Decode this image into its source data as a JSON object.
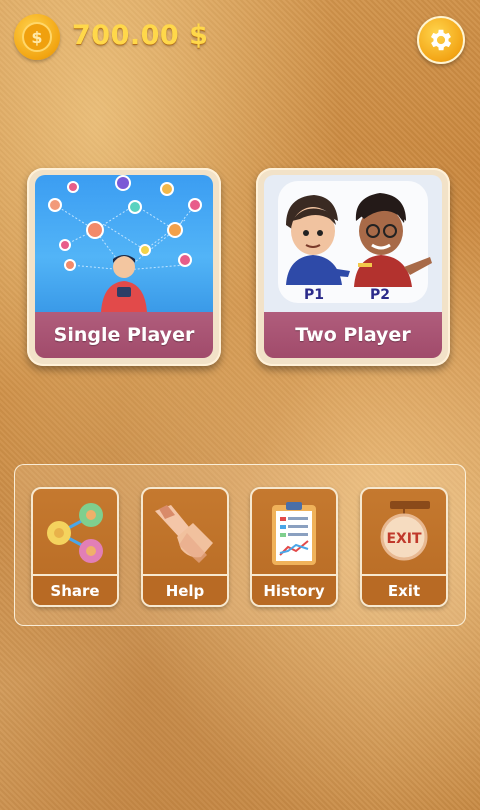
{
  "header": {
    "balance": "700.00 $",
    "coin_symbol": "$",
    "coin_icon": "coin-icon",
    "settings_icon": "gear-icon"
  },
  "modes": [
    {
      "label": "Single Player",
      "icon": "network-illustration"
    },
    {
      "label": "Two Player",
      "icon": "two-players-illustration",
      "badges": [
        "P1",
        "P2"
      ]
    }
  ],
  "menu": [
    {
      "label": "Share",
      "icon": "share-icon"
    },
    {
      "label": "Help",
      "icon": "handshake-icon"
    },
    {
      "label": "History",
      "icon": "clipboard-chart-icon"
    },
    {
      "label": "Exit",
      "icon": "exit-sign-icon",
      "sign_text": "EXIT"
    }
  ],
  "colors": {
    "accent_gold": "#ffd84a",
    "card_label": "#a14b6b",
    "menu_tile": "#b86b24"
  }
}
